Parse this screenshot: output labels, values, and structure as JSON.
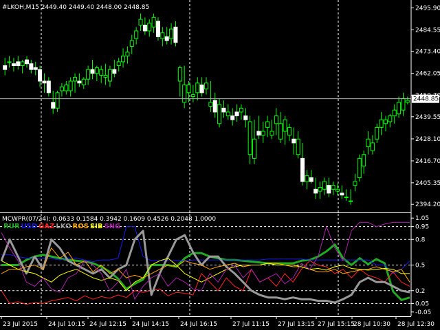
{
  "main_header": "#LKOH,M15  2449.40 2449.40 2448.00 2448.85",
  "price_axis": [
    "2495.90",
    "2484.55",
    "2473.40",
    "2462.05",
    "2450.70",
    "2439.55",
    "2428.10",
    "2416.70",
    "2405.35",
    "2394.20"
  ],
  "current_price_tag": "2448.85",
  "indicator_header": "MCWPR(07/24): 0.0633 0.1584 0.3942 0.1609 0.4526 0.2048 1.0000",
  "indicator_axis": [
    "1.05",
    "0.95",
    "0.8",
    "0.5",
    "0.2",
    "0.05",
    "-0.05"
  ],
  "time_axis": [
    "23 Jul 2015",
    "24 Jul 10:15",
    "24 Jul 12:15",
    "24 Jul 14:15",
    "24 Jul 16:15",
    "27 Jul 11:15",
    "27 Jul 13:15",
    "27 Jul 15:15",
    "28 Jul 10:30",
    "28 Jul 12:30"
  ],
  "legend": [
    {
      "name": "RUR",
      "color": "#22aa22"
    },
    {
      "name": "USD",
      "color": "#1a1aee"
    },
    {
      "name": "GAZ",
      "color": "#ff2222"
    },
    {
      "name": "LKO",
      "color": "#999999"
    },
    {
      "name": "ROS",
      "color": "#ffa500"
    },
    {
      "name": "SIB",
      "color": "#ffff00"
    },
    {
      "name": "SNG",
      "color": "#aa22aa"
    }
  ],
  "chart_data": {
    "type": "candlestick",
    "symbol": "#LKOH",
    "timeframe": "M15",
    "ylim": [
      2390,
      2500
    ],
    "candles": [
      [
        2466,
        2470,
        2461,
        2464
      ],
      [
        2468,
        2471,
        2465,
        2468
      ],
      [
        2467,
        2470,
        2463,
        2466
      ],
      [
        2468,
        2471,
        2464,
        2466
      ],
      [
        2466,
        2469,
        2462,
        2468
      ],
      [
        2469,
        2471,
        2465,
        2467
      ],
      [
        2467,
        2469,
        2462,
        2464
      ],
      [
        2465,
        2468,
        2461,
        2464
      ],
      [
        2464,
        2466,
        2455,
        2458
      ],
      [
        2458,
        2462,
        2452,
        2457
      ],
      [
        2458,
        2460,
        2450,
        2452
      ],
      [
        2447,
        2453,
        2441,
        2444
      ],
      [
        2444,
        2453,
        2442,
        2452
      ],
      [
        2453,
        2457,
        2450,
        2455
      ],
      [
        2453,
        2458,
        2451,
        2456
      ],
      [
        2453,
        2460,
        2450,
        2458
      ],
      [
        2458,
        2462,
        2452,
        2460
      ],
      [
        2458,
        2462,
        2455,
        2457
      ],
      [
        2456,
        2460,
        2454,
        2459
      ],
      [
        2459,
        2466,
        2456,
        2464
      ],
      [
        2464,
        2469,
        2459,
        2462
      ],
      [
        2462,
        2466,
        2458,
        2465
      ],
      [
        2461,
        2466,
        2457,
        2464
      ],
      [
        2460,
        2467,
        2456,
        2461
      ],
      [
        2458,
        2466,
        2455,
        2464
      ],
      [
        2464,
        2469,
        2460,
        2462
      ],
      [
        2466,
        2470,
        2463,
        2468
      ],
      [
        2468,
        2475,
        2465,
        2471
      ],
      [
        2471,
        2476,
        2467,
        2473
      ],
      [
        2476,
        2482,
        2472,
        2479
      ],
      [
        2480,
        2486,
        2477,
        2484
      ],
      [
        2487,
        2493,
        2484,
        2490
      ],
      [
        2487,
        2491,
        2482,
        2484
      ],
      [
        2484,
        2490,
        2481,
        2488
      ],
      [
        2486,
        2493,
        2483,
        2491
      ],
      [
        2489,
        2491,
        2479,
        2481
      ],
      [
        2480,
        2486,
        2476,
        2483
      ],
      [
        2481,
        2486,
        2477,
        2479
      ],
      [
        2480,
        2488,
        2477,
        2485
      ],
      [
        2486,
        2489,
        2476,
        2478
      ],
      [
        2458,
        2466,
        2450,
        2465
      ],
      [
        2447,
        2466,
        2444,
        2456
      ],
      [
        2452,
        2458,
        2447,
        2456
      ],
      [
        2450,
        2456,
        2447,
        2451
      ],
      [
        2452,
        2460,
        2448,
        2457
      ],
      [
        2456,
        2460,
        2450,
        2452
      ],
      [
        2454,
        2460,
        2451,
        2457
      ],
      [
        2445,
        2458,
        2442,
        2447
      ],
      [
        2448,
        2452,
        2439,
        2442
      ],
      [
        2436,
        2449,
        2434,
        2446
      ],
      [
        2444,
        2448,
        2439,
        2442
      ],
      [
        2440,
        2446,
        2438,
        2442
      ],
      [
        2440,
        2444,
        2435,
        2438
      ],
      [
        2442,
        2446,
        2437,
        2440
      ],
      [
        2442,
        2446,
        2438,
        2444
      ],
      [
        2440,
        2444,
        2434,
        2438
      ],
      [
        2420,
        2440,
        2415,
        2437
      ],
      [
        2418,
        2438,
        2415,
        2428
      ],
      [
        2432,
        2440,
        2428,
        2430
      ],
      [
        2430,
        2437,
        2426,
        2432
      ],
      [
        2434,
        2440,
        2429,
        2437
      ],
      [
        2430,
        2438,
        2428,
        2432
      ],
      [
        2436,
        2444,
        2430,
        2440
      ],
      [
        2428,
        2442,
        2426,
        2436
      ],
      [
        2432,
        2440,
        2425,
        2438
      ],
      [
        2430,
        2436,
        2427,
        2434
      ],
      [
        2428,
        2434,
        2420,
        2426
      ],
      [
        2420,
        2432,
        2418,
        2428
      ],
      [
        2418,
        2426,
        2404,
        2406
      ],
      [
        2406,
        2412,
        2402,
        2409
      ],
      [
        2408,
        2412,
        2405,
        2406
      ],
      [
        2402,
        2408,
        2397,
        2400
      ],
      [
        2401,
        2406,
        2397,
        2403
      ],
      [
        2402,
        2408,
        2399,
        2406
      ],
      [
        2404,
        2408,
        2398,
        2400
      ],
      [
        2402,
        2406,
        2399,
        2404
      ],
      [
        2401,
        2405,
        2399,
        2402
      ],
      [
        2400,
        2404,
        2397,
        2399
      ],
      [
        2398,
        2402,
        2396,
        2398
      ],
      [
        2396,
        2402,
        2394,
        2396
      ],
      [
        2404,
        2410,
        2401,
        2406
      ],
      [
        2408,
        2420,
        2406,
        2418
      ],
      [
        2414,
        2422,
        2410,
        2420
      ],
      [
        2424,
        2432,
        2420,
        2428
      ],
      [
        2422,
        2430,
        2420,
        2426
      ],
      [
        2428,
        2436,
        2426,
        2434
      ],
      [
        2434,
        2442,
        2430,
        2438
      ],
      [
        2436,
        2440,
        2432,
        2438
      ],
      [
        2437,
        2441,
        2434,
        2440
      ],
      [
        2440,
        2446,
        2436,
        2443
      ],
      [
        2441,
        2450,
        2439,
        2447
      ],
      [
        2443,
        2452,
        2440,
        2449
      ],
      [
        2447,
        2450,
        2446,
        2448
      ]
    ],
    "indicator": {
      "name": "MCWPR(07/24)",
      "ylim": [
        -0.1,
        1.1
      ],
      "levels": [
        0.95,
        0.8,
        0.5,
        0.2,
        0.05
      ],
      "series": [
        {
          "name": "RUR",
          "color": "#22aa22",
          "width": 3,
          "values": [
            0.5,
            0.5,
            0.5,
            0.56,
            0.6,
            0.62,
            0.6,
            0.58,
            0.56,
            0.55,
            0.54,
            0.52,
            0.48,
            0.42,
            0.34,
            0.22,
            0.28,
            0.33,
            0.5,
            0.5,
            0.5,
            0.48,
            0.58,
            0.64,
            0.64,
            0.6,
            0.58,
            0.56,
            0.56,
            0.55,
            0.54,
            0.53,
            0.52,
            0.52,
            0.52,
            0.52,
            0.55,
            0.56,
            0.6,
            0.66,
            0.74,
            0.58,
            0.5,
            0.58,
            0.51,
            0.57,
            0.52,
            0.19,
            0.09,
            0.12
          ]
        },
        {
          "name": "USD",
          "color": "#1a1aee",
          "width": 1,
          "values": [
            0.62,
            0.62,
            0.6,
            0.58,
            0.58,
            0.58,
            0.58,
            0.56,
            0.58,
            0.58,
            0.56,
            0.54,
            0.56,
            0.56,
            0.58,
            0.95,
            0.95,
            0.6,
            0.55,
            0.55,
            0.55,
            0.55,
            0.55,
            0.56,
            0.56,
            0.56,
            0.56,
            0.56,
            0.56,
            0.56,
            0.56,
            0.56,
            0.57,
            0.57,
            0.57,
            0.57,
            0.57,
            0.56,
            0.56,
            0.56,
            0.56,
            0.56,
            0.56,
            0.56,
            0.56,
            0.5,
            0.5,
            0.4,
            0.45,
            0.55
          ]
        },
        {
          "name": "GAZ",
          "color": "#ff2222",
          "width": 1,
          "values": [
            0.2,
            0.05,
            0.07,
            0.04,
            0.06,
            0.05,
            0.08,
            0.1,
            0.12,
            0.08,
            0.14,
            0.1,
            0.13,
            0.11,
            0.15,
            0.12,
            0.2,
            0.18,
            0.2,
            0.22,
            0.14,
            0.18,
            0.17,
            0.15,
            0.4,
            0.3,
            0.2,
            0.35,
            0.25,
            0.2,
            0.45,
            0.3,
            0.35,
            0.25,
            0.4,
            0.3,
            0.45,
            0.55,
            0.5,
            0.48,
            0.4,
            0.45,
            0.35,
            0.45,
            0.38,
            0.35,
            0.3,
            0.42,
            0.3,
            0.25
          ]
        },
        {
          "name": "LKO",
          "color": "#999999",
          "width": 3,
          "values": [
            0.55,
            0.8,
            0.6,
            0.4,
            0.6,
            0.45,
            0.8,
            0.7,
            0.55,
            0.5,
            0.45,
            0.4,
            0.45,
            0.35,
            0.45,
            0.5,
            0.8,
            0.9,
            0.15,
            0.4,
            0.6,
            0.8,
            0.85,
            0.65,
            0.5,
            0.6,
            0.6,
            0.48,
            0.4,
            0.3,
            0.2,
            0.15,
            0.12,
            0.12,
            0.1,
            0.12,
            0.1,
            0.1,
            0.08,
            0.08,
            0.06,
            0.1,
            0.15,
            0.3,
            0.35,
            0.3,
            0.3,
            0.25,
            0.2,
            0.18
          ]
        },
        {
          "name": "ROS",
          "color": "#ffa500",
          "width": 1,
          "values": [
            0.4,
            0.45,
            0.45,
            0.48,
            0.5,
            0.45,
            0.7,
            0.58,
            0.65,
            0.5,
            0.55,
            0.42,
            0.5,
            0.4,
            0.45,
            0.35,
            0.38,
            0.35,
            0.4,
            0.45,
            0.5,
            0.48,
            0.55,
            0.52,
            0.5,
            0.45,
            0.48,
            0.5,
            0.52,
            0.48,
            0.5,
            0.5,
            0.52,
            0.52,
            0.5,
            0.48,
            0.48,
            0.45,
            0.42,
            0.42,
            0.45,
            0.4,
            0.42,
            0.44,
            0.45,
            0.48,
            0.45,
            0.42,
            0.45,
            0.3
          ]
        },
        {
          "name": "SIB",
          "color": "#ffff00",
          "width": 1,
          "values": [
            0.55,
            0.5,
            0.45,
            0.42,
            0.4,
            0.35,
            0.3,
            0.38,
            0.42,
            0.45,
            0.4,
            0.35,
            0.32,
            0.35,
            0.32,
            0.2,
            0.3,
            0.35,
            0.5,
            0.55,
            0.58,
            0.5,
            0.4,
            0.35,
            0.3,
            0.35,
            0.4,
            0.45,
            0.48,
            0.5,
            0.5,
            0.5,
            0.52,
            0.5,
            0.5,
            0.5,
            0.48,
            0.45,
            0.46,
            0.44,
            0.48,
            0.5,
            0.46,
            0.45,
            0.44,
            0.45,
            0.46,
            0.45,
            0.4,
            0.4
          ]
        },
        {
          "name": "SNG",
          "color": "#aa22aa",
          "width": 1,
          "values": [
            0.88,
            0.7,
            0.55,
            0.3,
            0.25,
            0.35,
            0.22,
            0.18,
            0.35,
            0.4,
            0.55,
            0.5,
            0.4,
            0.2,
            0.3,
            0.45,
            0.1,
            0.25,
            0.35,
            0.4,
            0.25,
            0.35,
            0.3,
            0.22,
            0.2,
            0.4,
            0.3,
            0.45,
            0.5,
            0.35,
            0.45,
            0.3,
            0.35,
            0.4,
            0.28,
            0.35,
            0.52,
            0.45,
            0.6,
            0.95,
            0.7,
            0.55,
            0.9,
            1.0,
            1.0,
            0.95,
            0.98,
            1.0,
            1.0,
            1.0
          ]
        }
      ]
    }
  }
}
